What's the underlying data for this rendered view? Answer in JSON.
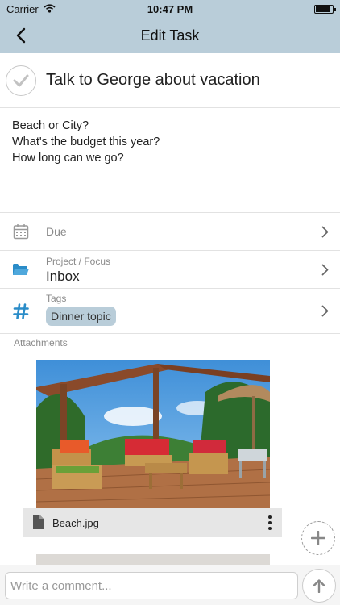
{
  "status_bar": {
    "carrier": "Carrier",
    "time": "10:47 PM",
    "battery_level": 0.95
  },
  "nav": {
    "title": "Edit Task",
    "back_icon": "chevron-left-icon"
  },
  "task": {
    "title": "Talk to George about vacation",
    "completed": false,
    "notes": [
      "Beach or City?",
      "What's the budget this year?",
      "How long can we go?"
    ]
  },
  "fields": {
    "due": {
      "label": "Due",
      "icon": "calendar-icon"
    },
    "project": {
      "label": "Project / Focus",
      "value": "Inbox",
      "icon": "folder-icon"
    },
    "tags": {
      "label": "Tags",
      "values": [
        "Dinner topic"
      ],
      "icon": "hash-icon"
    }
  },
  "attachments": {
    "label": "Attachments",
    "items": [
      {
        "file_name": "Beach.jpg"
      }
    ]
  },
  "comment": {
    "placeholder": "Write a comment..."
  },
  "colors": {
    "bar_background": "#b9cdd9",
    "accent_blue": "#2a8cc8",
    "tag_chip": "#b9cdd9",
    "file_bar": "#e6e6e6"
  }
}
